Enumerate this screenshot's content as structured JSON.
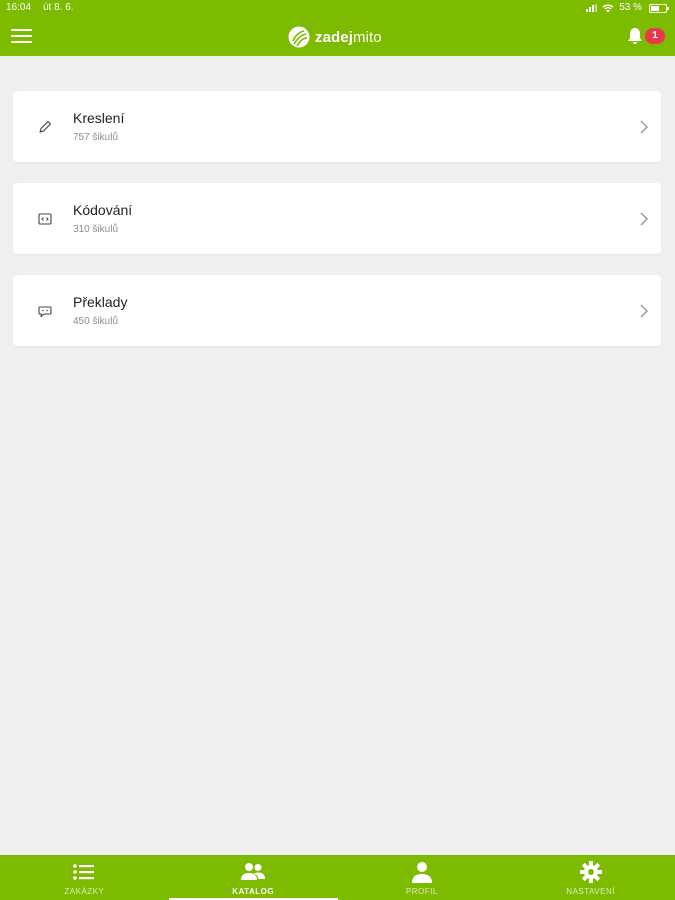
{
  "status_bar": {
    "time": "16:04",
    "date": "út 8. 6.",
    "battery": "53 %"
  },
  "header": {
    "logo_bold": "zadej",
    "logo_light": "mito",
    "notification_count": "1",
    "colors": {
      "brand": "#7dbb00",
      "badge": "#e8394b"
    }
  },
  "categories": [
    {
      "title": "Kreslení",
      "subtitle": "757 šikulů",
      "icon": "pencil-icon"
    },
    {
      "title": "Kódování",
      "subtitle": "310 šikulů",
      "icon": "code-icon"
    },
    {
      "title": "Překlady",
      "subtitle": "450 šikulů",
      "icon": "translate-icon"
    }
  ],
  "tabs": [
    {
      "label": "ZAKÁZKY",
      "icon": "list-icon",
      "active": false
    },
    {
      "label": "KATALOG",
      "icon": "people-icon",
      "active": true
    },
    {
      "label": "PROFIL",
      "icon": "person-icon",
      "active": false
    },
    {
      "label": "NASTAVENÍ",
      "icon": "gear-icon",
      "active": false
    }
  ]
}
